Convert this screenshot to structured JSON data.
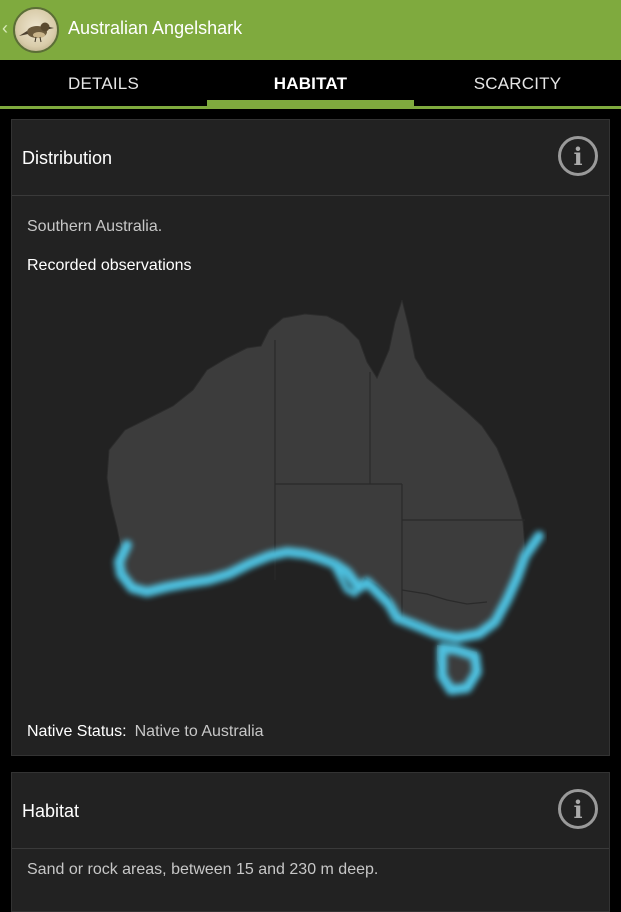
{
  "app": {
    "title": "Australian Angelshark",
    "icon": "bird-logo-icon",
    "accent_color": "#7faa3e"
  },
  "tabs": [
    {
      "label": "DETAILS",
      "active": false
    },
    {
      "label": "HABITAT",
      "active": true
    },
    {
      "label": "SCARCITY",
      "active": false
    }
  ],
  "distribution": {
    "title": "Distribution",
    "description": "Southern Australia.",
    "observations_heading": "Recorded observations",
    "status_label": "Native Status:",
    "status_value": "Native to Australia",
    "highlight_color": "#4fc8e8"
  },
  "habitat": {
    "title": "Habitat",
    "description": "Sand or rock areas, between 15 and 230 m deep."
  }
}
